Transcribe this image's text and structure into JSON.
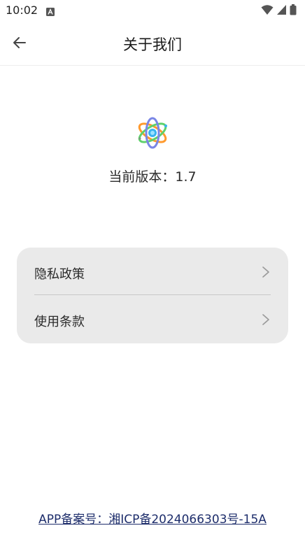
{
  "status_bar": {
    "time": "10:02"
  },
  "header": {
    "title": "关于我们"
  },
  "about": {
    "version_text": "当前版本：1.7"
  },
  "menu": {
    "items": [
      {
        "label": "隐私政策"
      },
      {
        "label": "使用条款"
      }
    ]
  },
  "footer": {
    "icp_text": "APP备案号：湘ICP备2024066303号-15A"
  },
  "colors": {
    "card_background": "#eaeaea",
    "link": "#1d2d6b"
  }
}
